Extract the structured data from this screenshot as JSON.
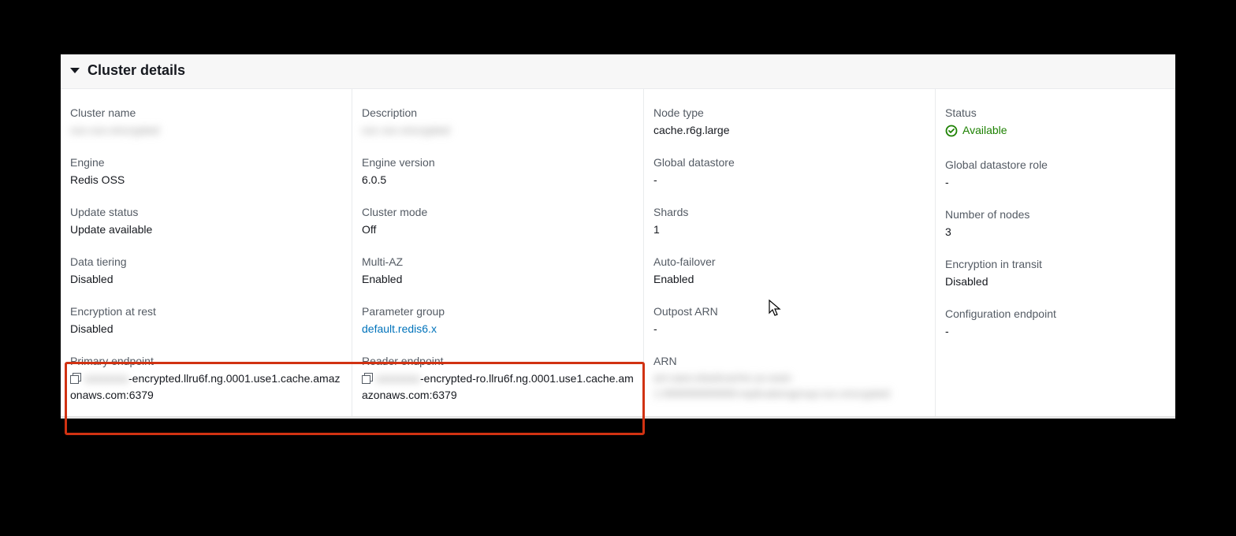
{
  "section_title": "Cluster details",
  "columns": {
    "c1": {
      "cluster_name_label": "Cluster name",
      "cluster_name_value": "xxx-xxx-encrypted",
      "engine_label": "Engine",
      "engine_value": "Redis OSS",
      "update_status_label": "Update status",
      "update_status_value": "Update available",
      "data_tiering_label": "Data tiering",
      "data_tiering_value": "Disabled",
      "encryption_rest_label": "Encryption at rest",
      "encryption_rest_value": "Disabled",
      "primary_endpoint_label": "Primary endpoint",
      "primary_endpoint_blur": "xxxxxxxx",
      "primary_endpoint_value": "-encrypted.llru6f.ng.0001.use1.cache.amazonaws.com:6379"
    },
    "c2": {
      "description_label": "Description",
      "description_value": "xxx xxx encrypted",
      "engine_version_label": "Engine version",
      "engine_version_value": "6.0.5",
      "cluster_mode_label": "Cluster mode",
      "cluster_mode_value": "Off",
      "multi_az_label": "Multi-AZ",
      "multi_az_value": "Enabled",
      "parameter_group_label": "Parameter group",
      "parameter_group_value": "default.redis6.x",
      "reader_endpoint_label": "Reader endpoint",
      "reader_endpoint_blur": "xxxxxxxx",
      "reader_endpoint_value": "-encrypted-ro.llru6f.ng.0001.use1.cache.amazonaws.com:6379"
    },
    "c3": {
      "node_type_label": "Node type",
      "node_type_value": "cache.r6g.large",
      "global_datastore_label": "Global datastore",
      "global_datastore_value": "-",
      "shards_label": "Shards",
      "shards_value": "1",
      "auto_failover_label": "Auto-failover",
      "auto_failover_value": "Enabled",
      "outpost_arn_label": "Outpost ARN",
      "outpost_arn_value": "-",
      "arn_label": "ARN",
      "arn_value": "arn:aws:elasticache:us-east-1:999999999999:replicationgroup:xxx-encrypted"
    },
    "c4": {
      "status_label": "Status",
      "status_value": "Available",
      "global_role_label": "Global datastore role",
      "global_role_value": "-",
      "num_nodes_label": "Number of nodes",
      "num_nodes_value": "3",
      "encryption_transit_label": "Encryption in transit",
      "encryption_transit_value": "Disabled",
      "config_endpoint_label": "Configuration endpoint",
      "config_endpoint_value": "-"
    }
  }
}
